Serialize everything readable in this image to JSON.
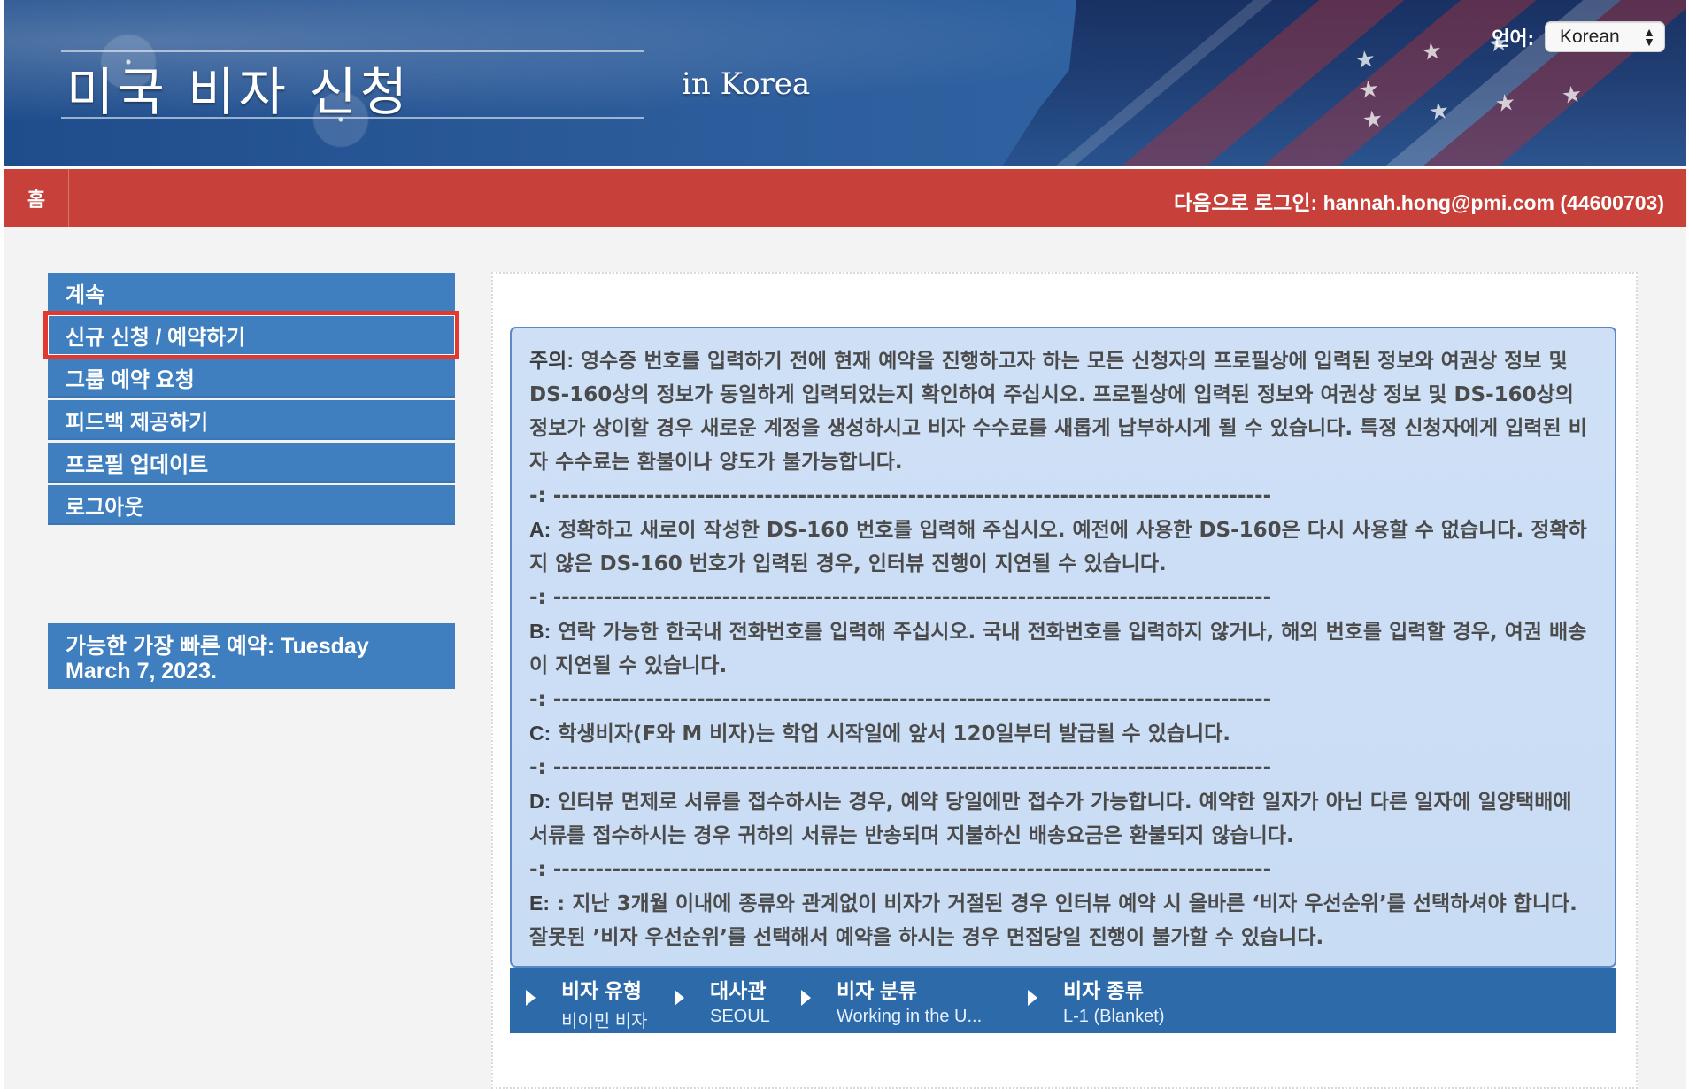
{
  "header": {
    "title": "미국 비자 신청",
    "subtitle": "in  Korea",
    "language_label": "언어:",
    "language_value": "Korean"
  },
  "nav": {
    "home": "홈",
    "login_text": "다음으로 로그인:  hannah.hong@pmi.com (44600703)"
  },
  "sidebar": {
    "items": [
      {
        "label": "계속"
      },
      {
        "label": "신규 신청 / 예약하기",
        "active": true
      },
      {
        "label": "그룹 예약 요청"
      },
      {
        "label": "피드백 제공하기"
      },
      {
        "label": "프로필 업데이트"
      },
      {
        "label": "로그아웃"
      }
    ],
    "earliest_appointment": "가능한 가장 빠른 예약: Tuesday March 7, 2023."
  },
  "notice": {
    "lines": [
      {
        "label": "주의:",
        "text": " 영수증 번호를 입력하기 전에 현재 예약을 진행하고자 하는 모든 신청자의 프로필상에 입력된 정보와 여권상 정보 및 DS-160상의 정보가 동일하게 입력되었는지 확인하여 주십시오. 프로필상에 입력된 정보와 여권상 정보 및 DS-160상의 정보가 상이할 경우 새로운 계정을 생성하시고 비자 수수료를 새롭게 납부하시게 될 수 있습니다. 특정 신청자에게 입력된 비자 수수료는 환불이나 양도가 불가능합니다."
      },
      {
        "separator": "-: -------------------------------------------------------------------------------------"
      },
      {
        "label": "A:",
        "text": " 정확하고 새로이 작성한 DS-160 번호를 입력해 주십시오. 예전에 사용한 DS-160은 다시 사용할 수 없습니다. 정확하지 않은 DS-160 번호가 입력된 경우, 인터뷰 진행이 지연될 수 있습니다."
      },
      {
        "separator": "-: -------------------------------------------------------------------------------------"
      },
      {
        "label": "B:",
        "text": " 연락 가능한 한국내 전화번호를 입력해 주십시오. 국내 전화번호를 입력하지 않거나, 해외 번호를 입력할 경우, 여권 배송이 지연될 수 있습니다."
      },
      {
        "separator": "-: -------------------------------------------------------------------------------------"
      },
      {
        "label": "C:",
        "text": " 학생비자(F와 M 비자)는 학업 시작일에 앞서 120일부터 발급될 수 있습니다."
      },
      {
        "separator": "-: -------------------------------------------------------------------------------------"
      },
      {
        "label": "D:",
        "text": " 인터뷰 면제로 서류를 접수하시는 경우, 예약 당일에만 접수가 가능합니다. 예약한 일자가 아닌 다른 일자에 일양택배에 서류를 접수하시는 경우 귀하의 서류는 반송되며 지불하신 배송요금은 환불되지 않습니다."
      },
      {
        "separator": "-: -------------------------------------------------------------------------------------"
      },
      {
        "label": "E:",
        "text": " : 지난 3개월 이내에 종류와 관계없이 비자가 거절된 경우 인터뷰 예약 시 올바른 ‘비자 우선순위’를 선택하셔야 합니다. 잘못된 ’비자 우선순위’를 선택해서 예약을 하시는 경우 면접당일 진행이 불가할 수 있습니다."
      }
    ]
  },
  "steps": [
    {
      "title": "비자 유형",
      "value": "비이민 비자"
    },
    {
      "title": "대사관",
      "value": "SEOUL"
    },
    {
      "title": "비자 분류",
      "value": "Working in the U..."
    },
    {
      "title": "비자 종류",
      "value": "L-1 (Blanket)"
    }
  ],
  "colors": {
    "header_blue": "#2b5a99",
    "nav_red": "#c7403a",
    "sidebar_blue": "#3f7fc0",
    "notice_blue": "#cfe0f6",
    "active_outline": "#e3382d"
  },
  "icons": {
    "select": "chevron-up-down-icon",
    "step": "right-arrow-icon"
  }
}
